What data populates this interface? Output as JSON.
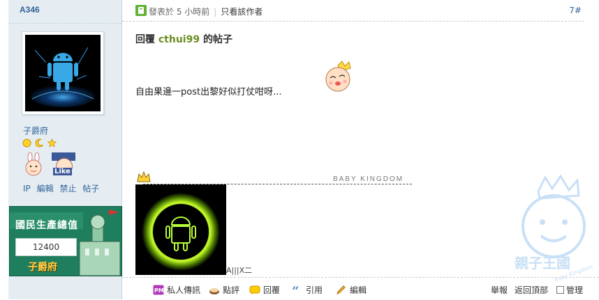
{
  "user": {
    "name": "A346",
    "rank": "子爵府",
    "links": [
      "IP",
      "編輯",
      "禁止",
      "帖子"
    ],
    "medal_badge": "Like"
  },
  "gdp": {
    "title": "國民生產總值",
    "value": "12400",
    "footer": "子爵府"
  },
  "post": {
    "meta": "發表於 5 小時前",
    "only_author": "只看該作者",
    "floor": "7#",
    "reply_prefix": "回覆",
    "reply_user": "cthui99",
    "reply_suffix": "的帖子",
    "message": "自由果邊一post出黎好似打仗咁呀...",
    "signature_brand": "BABY KINGDOM",
    "signature_text": "A|||X二"
  },
  "actions": {
    "left": [
      {
        "icon": "pm-icon",
        "label": "私人傳訊"
      },
      {
        "icon": "rate-icon",
        "label": "點評"
      },
      {
        "icon": "reply-icon",
        "label": "回覆"
      },
      {
        "icon": "quote-icon",
        "label": "引用"
      },
      {
        "icon": "edit-icon",
        "label": "編輯"
      }
    ],
    "report": "舉報",
    "back_to_top": "返回頂部",
    "manage": "管理"
  },
  "watermark": {
    "text": "親子王國",
    "subtext": "Baby Kingdom"
  },
  "colors": {
    "sidebar_bg": "#e5edf2",
    "link_blue": "#336699",
    "reply_user_green": "#6b8e23",
    "gdp_green": "#1e7e5d"
  }
}
